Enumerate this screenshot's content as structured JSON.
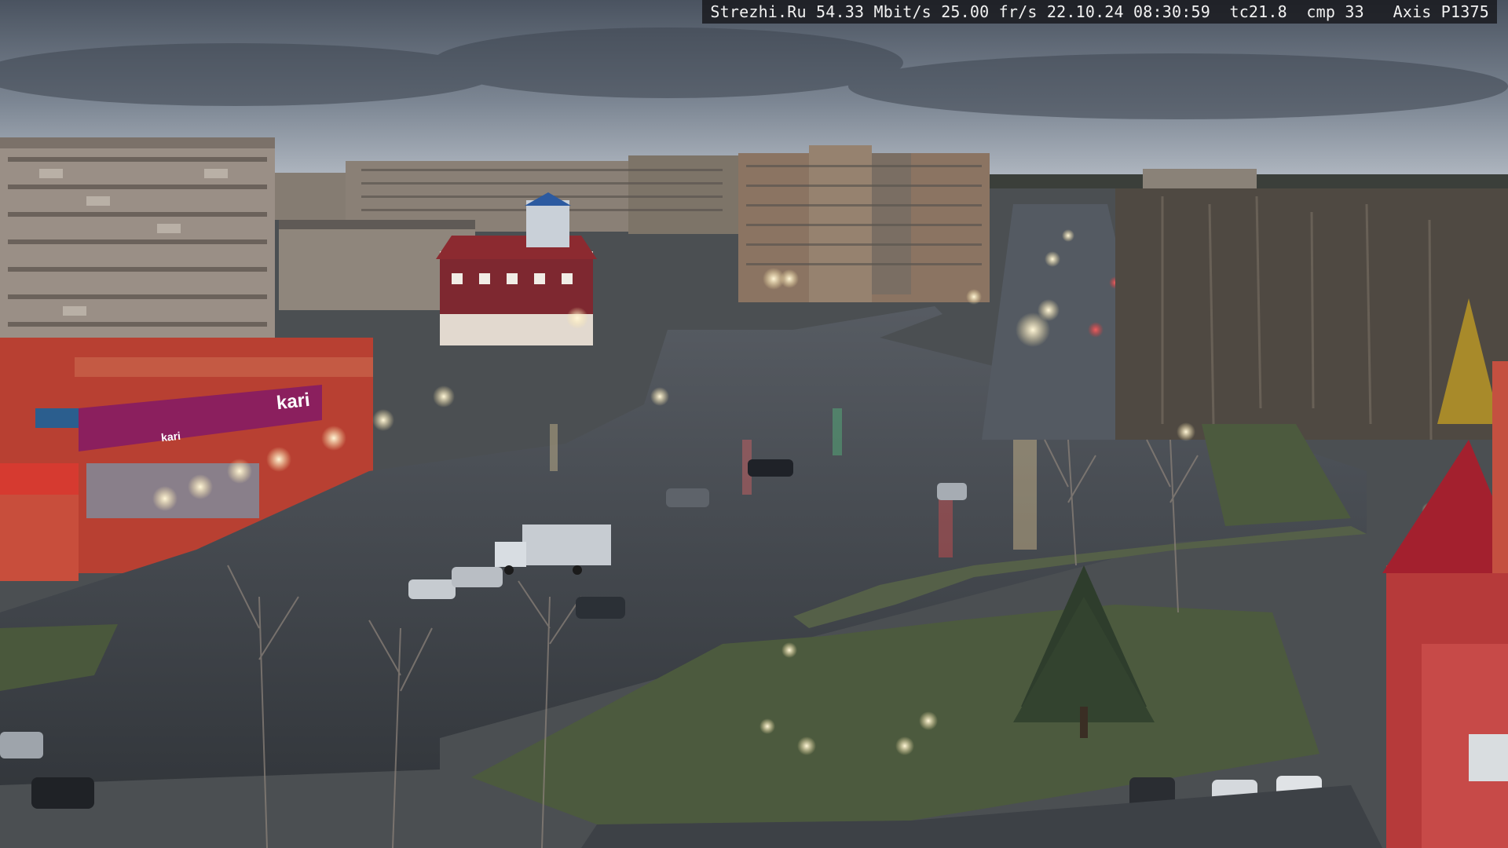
{
  "overlay": {
    "site": "Strezhi.Ru",
    "bitrate": "54.33 Mbit/s",
    "framerate": "25.00 fr/s",
    "datetime": "22.10.24 08:30:59",
    "tc": "tc21.8",
    "cmp": "cmp 33",
    "camera": "Axis P1375"
  },
  "signs": {
    "store_brand": "kari",
    "store_brand_small": "kari"
  },
  "colors": {
    "sky_top": "#5a6470",
    "sky_bottom": "#b4bcc6",
    "asphalt": "#3c4046",
    "grass": "#4a5a3c",
    "building_beige": "#8a7f74",
    "storefront_red": "#b83a2e",
    "kari_magenta": "#8a1e58"
  }
}
